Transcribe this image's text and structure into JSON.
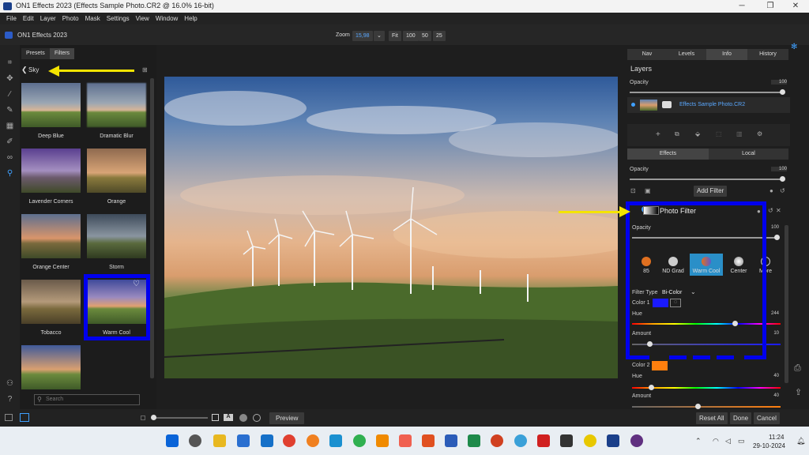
{
  "window": {
    "title": "ON1 Effects 2023 (Effects Sample Photo.CR2 @ 16.0% 16-bit)",
    "min": "─",
    "max": "❐",
    "close": "✕"
  },
  "menu": [
    "File",
    "Edit",
    "Layer",
    "Photo",
    "Mask",
    "Settings",
    "View",
    "Window",
    "Help"
  ],
  "appbar": {
    "app_name": "ON1 Effects 2023",
    "zoom_label": "Zoom",
    "zoom_value": "15,98",
    "zoom_opts": [
      "Fit",
      "100",
      "50",
      "25"
    ]
  },
  "left": {
    "tabs": [
      "Presets",
      "Filters"
    ],
    "breadcrumb": "Sky",
    "search_placeholder": "Search",
    "thumbs": [
      "Deep Blue",
      "Dramatic Blur",
      "Lavender Corners",
      "Orange",
      "Orange Center",
      "Storm",
      "Tobacco",
      "Warm Cool",
      ""
    ]
  },
  "right": {
    "tabs": [
      "Nav",
      "Levels",
      "Info",
      "History"
    ],
    "layers_title": "Layers",
    "opacity_label": "Opacity",
    "opacity_value": "100",
    "layer_name": "Effects Sample Photo.CR2",
    "effects_tabs": [
      "Effects",
      "Local"
    ],
    "opacity2_value": "100",
    "add_filter": "Add Filter",
    "filter_title": "Photo Filter",
    "filter_opacity_label": "Opacity",
    "filter_opacity_value": "100",
    "chips": [
      "85",
      "ND Grad",
      "Warm Cool",
      "Center",
      "More"
    ],
    "filter_type_label": "Filter Type",
    "filter_type_value": "Bi-Color",
    "color1_label": "Color 1",
    "hue_label": "Hue",
    "hue1_value": "244",
    "amount_label": "Amount",
    "amount1_value": "10",
    "color2_label": "Color 2",
    "hue2_value": "40",
    "amount2_value": "40",
    "color1": "#1a1aff",
    "color2": "#ff7f0e"
  },
  "bottom": {
    "preview": "Preview",
    "reset_all": "Reset All",
    "done": "Done",
    "cancel": "Cancel"
  },
  "taskbar": {
    "time": "11:24",
    "date": "29-10-2024"
  },
  "annotation_color": "#0000ee"
}
